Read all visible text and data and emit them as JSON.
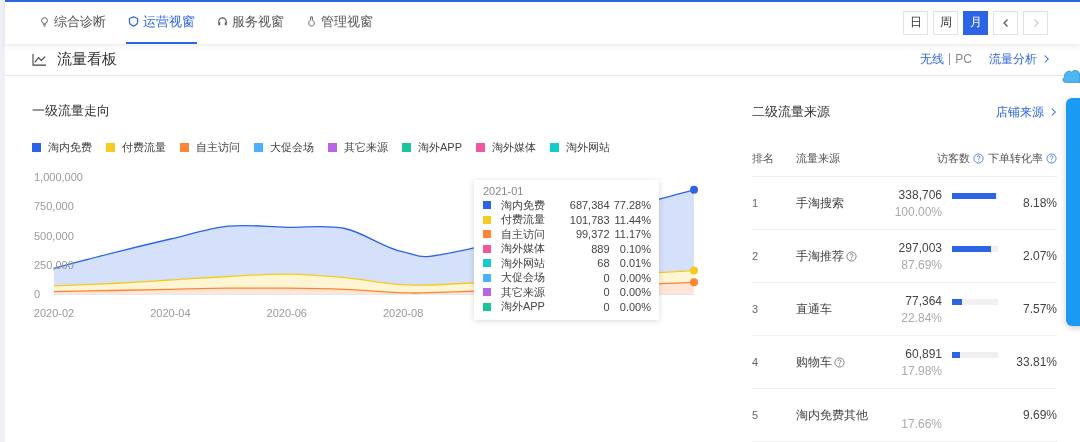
{
  "tabs": [
    {
      "label": "综合诊断",
      "selected": false
    },
    {
      "label": "运营视窗",
      "selected": true
    },
    {
      "label": "服务视窗",
      "selected": false
    },
    {
      "label": "管理视窗",
      "selected": false
    }
  ],
  "periods": [
    {
      "label": "日",
      "selected": false
    },
    {
      "label": "周",
      "selected": false
    },
    {
      "label": "月",
      "selected": true
    }
  ],
  "pager": [
    {
      "kind": "prev",
      "disabled": false
    },
    {
      "kind": "next",
      "disabled": true
    }
  ],
  "board": {
    "title": "流量看板",
    "terminals": [
      {
        "label": "无线",
        "selected": true
      },
      {
        "label": "PC",
        "selected": false
      }
    ],
    "link": "流量分析"
  },
  "primary": {
    "title": "一级流量走向",
    "legend": [
      {
        "label": "淘内免费",
        "color": "#2d64e6"
      },
      {
        "label": "付费流量",
        "color": "#f5cb22"
      },
      {
        "label": "自主访问",
        "color": "#ff8433"
      },
      {
        "label": "大促会场",
        "color": "#4db0ff"
      },
      {
        "label": "其它来源",
        "color": "#b764e6"
      },
      {
        "label": "淘外APP",
        "color": "#1cc49c"
      },
      {
        "label": "淘外媒体",
        "color": "#f2579e"
      },
      {
        "label": "淘外网站",
        "color": "#14cccc"
      }
    ],
    "chart_data": {
      "type": "area",
      "stacked": true,
      "categories": [
        "2020-02",
        null,
        "2020-04",
        null,
        "2020-06",
        null,
        "2020-08",
        null,
        null,
        null,
        null,
        null
      ],
      "series": [
        {
          "color": "#2d64e6",
          "values": [
            150000,
            260000,
            350000,
            430000,
            400000,
            420000,
            280000,
            280000,
            null,
            null,
            null,
            690000
          ]
        },
        {
          "color": "#f5cb22",
          "values": [
            50000,
            60000,
            80000,
            100000,
            120000,
            100000,
            70000,
            70000,
            null,
            null,
            null,
            100000
          ]
        },
        {
          "color": "#ff8433",
          "values": [
            20000,
            30000,
            40000,
            50000,
            50000,
            40000,
            10000,
            20000,
            null,
            null,
            null,
            100000
          ]
        }
      ],
      "ylim": [
        0,
        1000000
      ],
      "yticks": [
        {
          "value": 0,
          "label": "0"
        },
        {
          "value": 250000,
          "label": "250,000"
        },
        {
          "value": 500000,
          "label": "500,000"
        },
        {
          "value": 750000,
          "label": "750,000"
        },
        {
          "value": 1000000,
          "label": "1,000,000"
        }
      ]
    },
    "tooltip": {
      "title": "2021-01",
      "rows": [
        {
          "name": "淘内免费",
          "value": "687,384",
          "share": "77.28%",
          "color": "#2d64e6"
        },
        {
          "name": "付费流量",
          "value": "101,783",
          "share": "11.44%",
          "color": "#f5cb22"
        },
        {
          "name": "自主访问",
          "value": "99,372",
          "share": "11.17%",
          "color": "#ff8433"
        },
        {
          "name": "淘外媒体",
          "value": "889",
          "share": "0.10%",
          "color": "#f2579e"
        },
        {
          "name": "淘外网站",
          "value": "68",
          "share": "0.01%",
          "color": "#14cccc"
        },
        {
          "name": "大促会场",
          "value": "0",
          "share": "0.00%",
          "color": "#4db0ff"
        },
        {
          "name": "其它来源",
          "value": "0",
          "share": "0.00%",
          "color": "#b764e6"
        },
        {
          "name": "淘外APP",
          "value": "0",
          "share": "0.00%",
          "color": "#1cc49c"
        }
      ]
    }
  },
  "secondary": {
    "title": "二级流量来源",
    "link": "店铺来源",
    "columns": [
      {
        "label": "排名",
        "help": false
      },
      {
        "label": "流量来源",
        "help": false
      },
      {
        "label": "访客数",
        "help": true
      },
      {
        "label": "下单转化率",
        "help": true
      }
    ],
    "rows": [
      {
        "rank": "1",
        "source": "手淘搜索",
        "help": false,
        "visitors": "338,706",
        "share": "100.00%",
        "level": 1.0,
        "conversion": "8.18%"
      },
      {
        "rank": "2",
        "source": "手淘推荐",
        "help": true,
        "visitors": "297,003",
        "share": "87.69%",
        "level": 0.88,
        "conversion": "2.07%"
      },
      {
        "rank": "3",
        "source": "直通车",
        "help": false,
        "visitors": "77,364",
        "share": "22.84%",
        "level": 0.23,
        "conversion": "7.57%"
      },
      {
        "rank": "4",
        "source": "购物车",
        "help": true,
        "visitors": "60,891",
        "share": "17.98%",
        "level": 0.18,
        "conversion": "33.81%"
      },
      {
        "rank": "5",
        "source": "淘内免费其他",
        "help": false,
        "share": "17.66%",
        "conversion": "9.69%"
      }
    ]
  }
}
